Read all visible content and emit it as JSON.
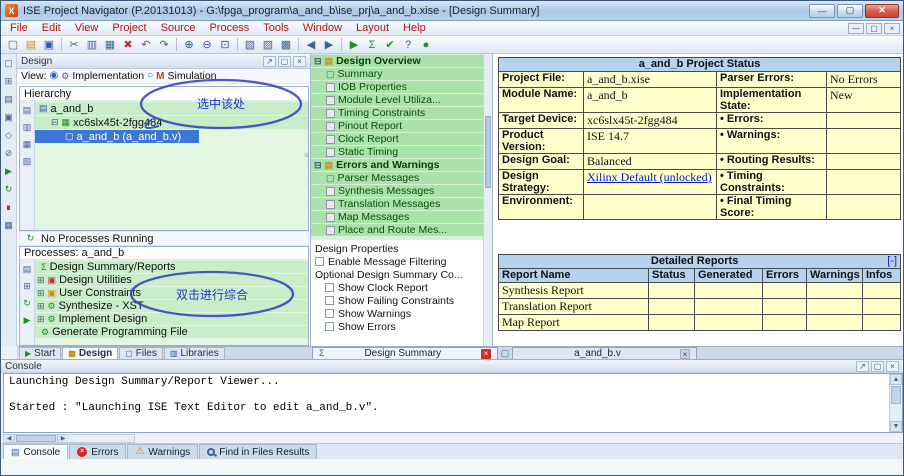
{
  "window": {
    "title": "ISE Project Navigator (P.20131013) - G:\\fpga_program\\a_and_b\\ise_prj\\a_and_b.xise - [Design Summary]"
  },
  "icons": {
    "app": "X",
    "minimize": "—",
    "maximize": "▢",
    "close": "✕",
    "close_small": "×",
    "expander_open": "⊟",
    "expander_closed": "⊞",
    "radio_on": "◉",
    "radio_off": "○",
    "impl_gear": "⚙",
    "sim_m": "M",
    "scroll_up": "▲",
    "scroll_down": "▼",
    "scroll_left": "◀",
    "scroll_right": "▶",
    "grip": "≡",
    "refresh": "↻",
    "float": "↗"
  },
  "menubar": {
    "items": [
      "File",
      "Edit",
      "View",
      "Project",
      "Source",
      "Process",
      "Tools",
      "Window",
      "Layout",
      "Help"
    ]
  },
  "toolbar": {
    "icons": [
      {
        "name": "new-file-icon",
        "glyph": "▢"
      },
      {
        "name": "open-project-icon",
        "glyph": "▤"
      },
      {
        "name": "save-icon",
        "glyph": "▣"
      },
      {
        "name": "cut-icon",
        "glyph": "✂"
      },
      {
        "name": "copy-icon",
        "glyph": "▥"
      },
      {
        "name": "paste-icon",
        "glyph": "▦"
      },
      {
        "name": "delete-icon",
        "glyph": "✖"
      },
      {
        "name": "undo-icon",
        "glyph": "↶"
      },
      {
        "name": "redo-icon",
        "glyph": "↷"
      },
      {
        "name": "zoom-in-icon",
        "glyph": "⊕"
      },
      {
        "name": "zoom-out-icon",
        "glyph": "⊖"
      },
      {
        "name": "zoom-full-icon",
        "glyph": "⊡"
      },
      {
        "name": "new-window-icon",
        "glyph": "▧"
      },
      {
        "name": "cascade-windows-icon",
        "glyph": "▨"
      },
      {
        "name": "tile-windows-icon",
        "glyph": "▩"
      },
      {
        "name": "navigate-back-icon",
        "glyph": "◀"
      },
      {
        "name": "navigate-forward-icon",
        "glyph": "▶"
      },
      {
        "name": "run-icon",
        "glyph": "▶"
      },
      {
        "name": "summary-icon",
        "glyph": "Σ"
      },
      {
        "name": "check-icon",
        "glyph": "✔"
      },
      {
        "name": "help-icon",
        "glyph": "?"
      },
      {
        "name": "indicator-icon",
        "glyph": "●"
      }
    ]
  },
  "leftbar": {
    "icons": [
      {
        "name": "new-source-icon",
        "glyph": "▢"
      },
      {
        "name": "add-source-icon",
        "glyph": "⊞"
      },
      {
        "name": "open-source-icon",
        "glyph": "▤"
      },
      {
        "name": "edit-source-icon",
        "glyph": "▣"
      },
      {
        "name": "toggle-view-icon",
        "glyph": "◇"
      },
      {
        "name": "disable-icon",
        "glyph": "⊘"
      },
      {
        "name": "run-process-icon",
        "glyph": "▶"
      },
      {
        "name": "rerun-icon",
        "glyph": "↻"
      },
      {
        "name": "stop-process-icon",
        "glyph": "∎"
      },
      {
        "name": "report-icon",
        "glyph": "▦"
      }
    ]
  },
  "hier_toolbar": {
    "icons": [
      {
        "name": "view-sources-icon",
        "glyph": "▤"
      },
      {
        "name": "view-snapshots-icon",
        "glyph": "▥"
      },
      {
        "name": "view-libraries-icon",
        "glyph": "▦"
      },
      {
        "name": "hierarchy-props-icon",
        "glyph": "▧"
      }
    ]
  },
  "proc_toolbar": {
    "icons": [
      {
        "name": "processes-view-icon",
        "glyph": "▤"
      },
      {
        "name": "expand-all-icon",
        "glyph": "⊞"
      },
      {
        "name": "rerun-all-icon",
        "glyph": "↻"
      },
      {
        "name": "run-selected-icon",
        "glyph": "▶"
      }
    ]
  },
  "design": {
    "panel_title": "Design",
    "view_label": "View:",
    "impl": "Implementation",
    "sim": "Simulation",
    "hierarchy_title": "Hierarchy",
    "tree": {
      "project": "a_and_b",
      "device": "xc6slx45t-2fgg484",
      "module": "a_and_b (a_and_b.v)"
    },
    "annotation_select": "选中该处",
    "no_processes": "No Processes Running",
    "processes_title": "Processes: a_and_b",
    "processes": [
      {
        "label": "Design Summary/Reports",
        "glyph": "Σ"
      },
      {
        "label": "Design Utilities",
        "glyph": "▣"
      },
      {
        "label": "User Constraints",
        "glyph": "▣"
      },
      {
        "label": "Synthesize - XST",
        "glyph": "⚙"
      },
      {
        "label": "Implement Design",
        "glyph": "⚙"
      },
      {
        "label": "Generate Programming File",
        "glyph": "⚙"
      }
    ],
    "annotation_synth": "双击进行综合",
    "tabs": [
      "Start",
      "Design",
      "Files",
      "Libraries"
    ]
  },
  "overview": {
    "root": "Design Overview",
    "items": [
      "Summary",
      "IOB Properties",
      "Module Level Utiliza...",
      "Timing Constraints",
      "Pinout Report",
      "Clock Report",
      "Static Timing"
    ],
    "errors_root": "Errors and Warnings",
    "errors_items": [
      "Parser Messages",
      "Synthesis Messages",
      "Translation Messages",
      "Map Messages",
      "Place and Route Mes..."
    ],
    "properties": {
      "title": "Design Properties",
      "enable_filtering": "Enable Message Filtering",
      "optional_title": "Optional Design Summary Co...",
      "options": [
        "Show Clock Report",
        "Show Failing Constraints",
        "Show Warnings",
        "Show Errors"
      ]
    },
    "tab_label": "Design Summary"
  },
  "status": {
    "title": "a_and_b Project Status",
    "rows": [
      {
        "l1": "Project File:",
        "v1": "a_and_b.xise",
        "l2": "Parser Errors:",
        "v2": "No Errors"
      },
      {
        "l1": "Module Name:",
        "v1": "a_and_b",
        "l2": "Implementation State:",
        "v2": "New"
      },
      {
        "l1": "Target Device:",
        "v1": "xc6slx45t-2fgg484",
        "l2": "• Errors:",
        "v2": ""
      },
      {
        "l1": "Product Version:",
        "v1": "ISE 14.7",
        "l2": "• Warnings:",
        "v2": ""
      },
      {
        "l1": "Design Goal:",
        "v1": "Balanced",
        "l2": "• Routing Results:",
        "v2": ""
      },
      {
        "l1": "Design Strategy:",
        "v1": "Xilinx Default (unlocked)",
        "l2": "• Timing Constraints:",
        "v2": ""
      },
      {
        "l1": "Environment:",
        "v1": "",
        "l2": "• Final Timing Score:",
        "v2": ""
      }
    ]
  },
  "reports": {
    "title": "Detailed Reports",
    "collapse": "[-]",
    "headers": [
      "Report Name",
      "Status",
      "Generated",
      "Errors",
      "Warnings",
      "Infos"
    ],
    "rows": [
      "Synthesis Report",
      "Translation Report",
      "Map Report"
    ]
  },
  "editor": {
    "tab_label": "a_and_b.v"
  },
  "console": {
    "title": "Console",
    "lines": [
      "Launching Design Summary/Report Viewer...",
      "",
      "Started : \"Launching ISE Text Editor to edit a_and_b.v\"."
    ],
    "tabs": [
      "Console",
      "Errors",
      "Warnings",
      "Find in Files Results"
    ]
  }
}
